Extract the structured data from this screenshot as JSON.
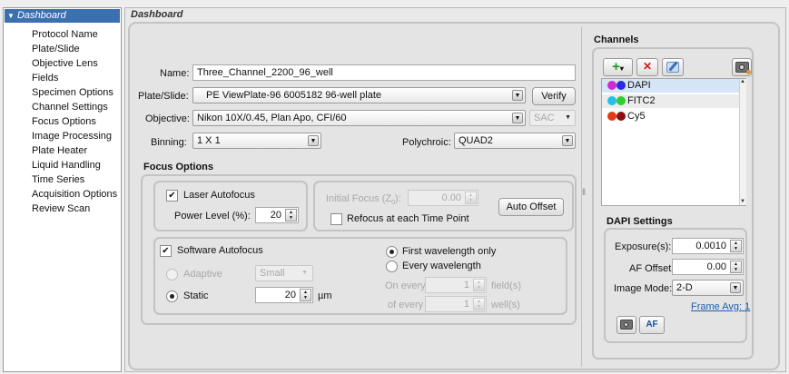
{
  "sidebar": {
    "header": "Dashboard",
    "collapse_glyph": "▼",
    "items": [
      {
        "label": "Protocol Name"
      },
      {
        "label": "Plate/Slide"
      },
      {
        "label": "Objective Lens"
      },
      {
        "label": "Fields"
      },
      {
        "label": "Specimen Options"
      },
      {
        "label": "Channel Settings"
      },
      {
        "label": "Focus Options"
      },
      {
        "label": "Image Processing"
      },
      {
        "label": "Plate Heater"
      },
      {
        "label": "Liquid Handling"
      },
      {
        "label": "Time Series"
      },
      {
        "label": "Acquisition Options"
      },
      {
        "label": "Review Scan"
      }
    ]
  },
  "main": {
    "title": "Dashboard",
    "name_label": "Name:",
    "name_value": "Three_Channel_2200_96_well",
    "plate_label": "Plate/Slide:",
    "plate_value": "PE ViewPlate-96 6005182 96-well plate",
    "verify_label": "Verify",
    "objective_label": "Objective:",
    "objective_value": "Nikon 10X/0.45, Plan Apo, CFI/60",
    "sac_value": "SAC",
    "binning_label": "Binning:",
    "binning_value": "1 X 1",
    "polychroic_label": "Polychroic:",
    "polychroic_value": "QUAD2"
  },
  "focus": {
    "section_title": "Focus Options",
    "laser_autofocus_label": "Laser Autofocus",
    "laser_autofocus_checked": true,
    "power_level_label": "Power Level (%):",
    "power_level_value": "20",
    "initial_focus_label": "Initial Focus (Z",
    "initial_focus_sub": "0",
    "initial_focus_suffix": "):",
    "initial_focus_value": "0.00",
    "refocus_label": "Refocus at each Time Point",
    "refocus_checked": false,
    "auto_offset_label": "Auto Offset",
    "software_autofocus_label": "Software Autofocus",
    "software_autofocus_checked": true,
    "adaptive_label": "Adaptive",
    "adaptive_value": "Small",
    "static_label": "Static",
    "static_value": "20",
    "static_unit": "µm",
    "first_wavelength_label": "First wavelength only",
    "every_wavelength_label": "Every wavelength",
    "on_every_label": "On every",
    "on_every_value": "1",
    "fields_label": "field(s)",
    "of_every_label": "of every",
    "of_every_value": "1",
    "wells_label": "well(s)"
  },
  "channels": {
    "title": "Channels",
    "add_glyph": "+",
    "add_dropdown_glyph": "▾",
    "delete_glyph": "✕",
    "list": [
      {
        "name": "DAPI",
        "color1": "#d428d4",
        "color2": "#2a2ae0"
      },
      {
        "name": "FITC2",
        "color1": "#22c0ea",
        "color2": "#33cc33"
      },
      {
        "name": "Cy5",
        "color1": "#e23a14",
        "color2": "#8a1010"
      }
    ],
    "settings_title": "DAPI Settings",
    "exposure_label": "Exposure(s):",
    "exposure_value": "0.0010",
    "af_offset_label": "AF Offset:",
    "af_offset_value": "0.00",
    "image_mode_label": "Image Mode:",
    "image_mode_value": "2-D",
    "frame_avg_label": "Frame Avg: 1",
    "af_button_label": "AF"
  },
  "glyphs": {
    "dropdown": "▼",
    "spin_up": "▲",
    "spin_down": "▼",
    "check": "✔",
    "splitter": "‖"
  },
  "colors": {
    "sidebar_header_bg": "#3a6fb0",
    "link": "#1a5fb4",
    "add_green": "#1c9a1c",
    "delete_red": "#d21c1c"
  }
}
